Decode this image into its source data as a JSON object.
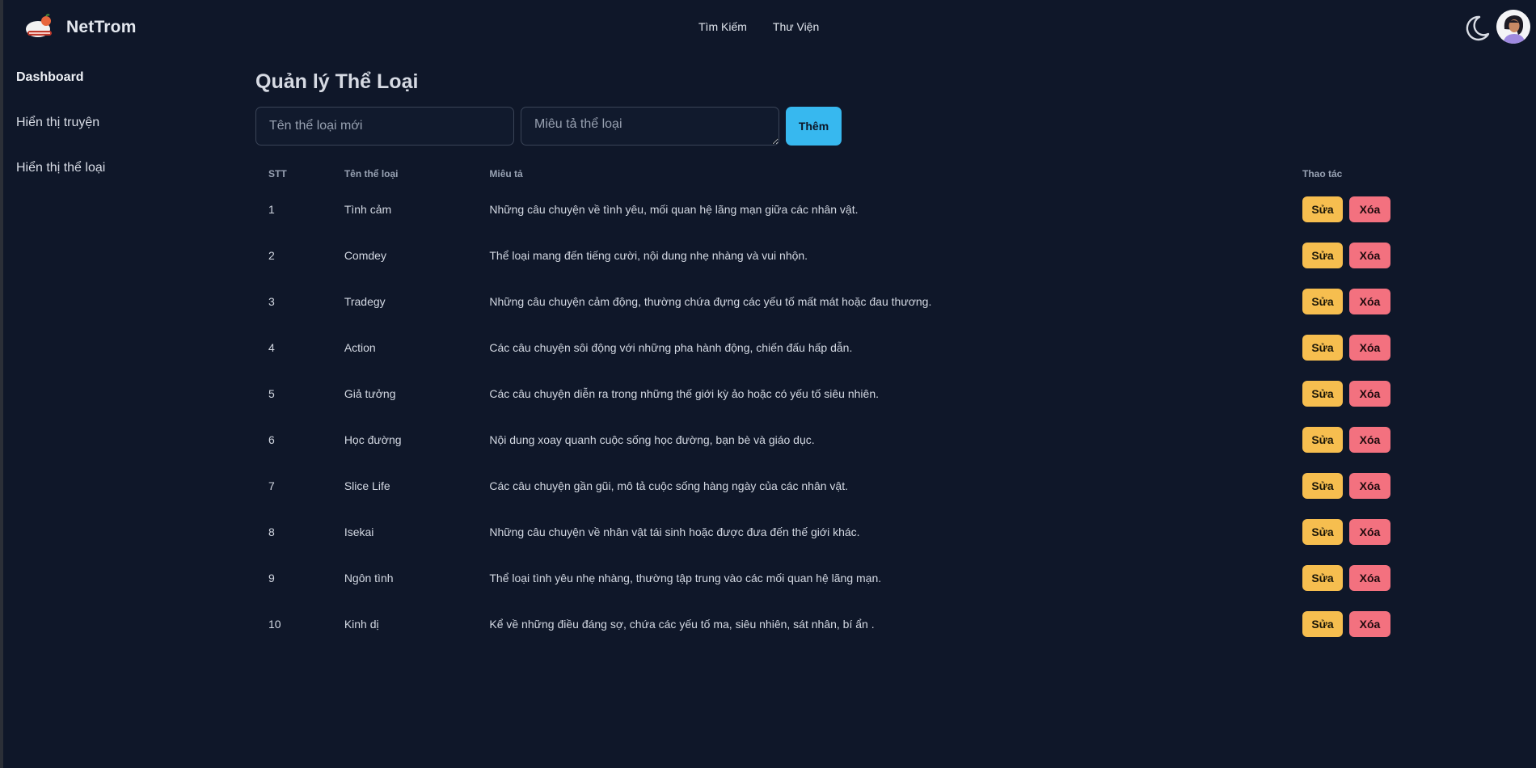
{
  "app": {
    "name": "NetTrom",
    "colors": {
      "background": "#0f1729",
      "accent": "#37b8ef",
      "edit": "#f6be4f",
      "delete": "#f3717f"
    }
  },
  "header": {
    "nav": [
      {
        "label": "Tìm Kiếm"
      },
      {
        "label": "Thư Viện"
      }
    ],
    "theme_icon": "moon-icon",
    "avatar_icon": "user-avatar"
  },
  "sidebar": {
    "items": [
      {
        "label": "Dashboard",
        "active": true
      },
      {
        "label": "Hiển thị truyện"
      },
      {
        "label": "Hiển thị thể loại"
      }
    ]
  },
  "main": {
    "title": "Quản lý Thể Loại",
    "form": {
      "name_placeholder": "Tên thể loại mới",
      "desc_placeholder": "Miêu tả thể loại",
      "add_label": "Thêm"
    },
    "table": {
      "headers": {
        "stt": "STT",
        "name": "Tên thể loại",
        "desc": "Miêu tả",
        "actions": "Thao tác"
      },
      "edit_label": "Sửa",
      "delete_label": "Xóa",
      "rows": [
        {
          "stt": "1",
          "name": "Tình cảm",
          "desc": "Những câu chuyện về tình yêu, mối quan hệ lãng mạn giữa các nhân vật."
        },
        {
          "stt": "2",
          "name": "Comdey",
          "desc": "Thể loại mang đến tiếng cười, nội dung nhẹ nhàng và vui nhộn."
        },
        {
          "stt": "3",
          "name": "Tradegy",
          "desc": "Những câu chuyện cảm động, thường chứa đựng các yếu tố mất mát hoặc đau thương."
        },
        {
          "stt": "4",
          "name": "Action",
          "desc": "Các câu chuyện sôi động với những pha hành động, chiến đấu hấp dẫn."
        },
        {
          "stt": "5",
          "name": "Giả tưởng",
          "desc": "Các câu chuyện diễn ra trong những thế giới kỳ ảo hoặc có yếu tố siêu nhiên."
        },
        {
          "stt": "6",
          "name": "Học đường",
          "desc": "Nội dung xoay quanh cuộc sống học đường, bạn bè và giáo dục."
        },
        {
          "stt": "7",
          "name": "Slice Life",
          "desc": "Các câu chuyện gần gũi, mô tả cuộc sống hàng ngày của các nhân vật."
        },
        {
          "stt": "8",
          "name": "Isekai",
          "desc": "Những câu chuyện về nhân vật tái sinh hoặc được đưa đến thế giới khác."
        },
        {
          "stt": "9",
          "name": "Ngôn tình",
          "desc": "Thể loại tình yêu nhẹ nhàng, thường tập trung vào các mối quan hệ lãng mạn."
        },
        {
          "stt": "10",
          "name": "Kinh dị",
          "desc": "Kể về những điều đáng sợ, chứa các yếu tố ma, siêu nhiên, sát nhân, bí ẩn ."
        }
      ]
    }
  }
}
